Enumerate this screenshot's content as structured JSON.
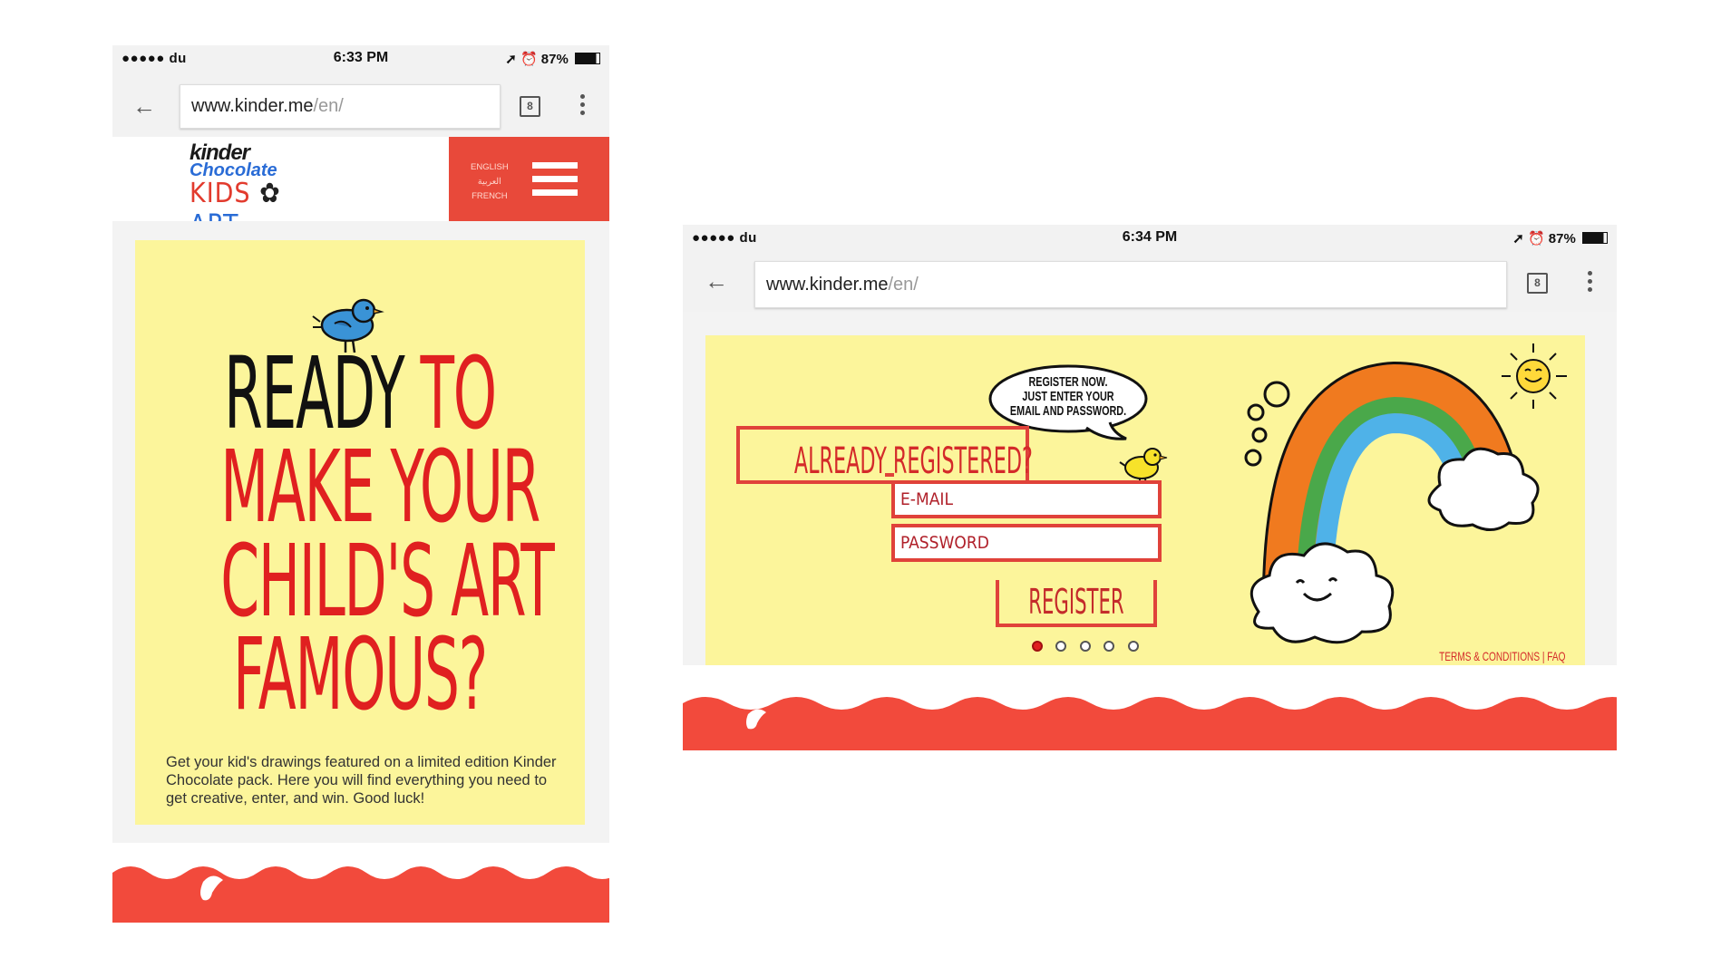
{
  "phone1": {
    "status": {
      "carrier": "●●●●● du",
      "time": "6:33 PM",
      "battery": "87%"
    },
    "browser": {
      "url_host": "www.kinder.me",
      "url_path": "/en/",
      "tab_count": "8"
    },
    "logo": {
      "line1": "kinder",
      "line2": "Chocolate",
      "line3": "KIDS",
      "line4": "ART"
    },
    "languages": [
      "ENGLISH",
      "العربية",
      "FRENCH"
    ],
    "headline": {
      "w1": "READY",
      "w2": "TO",
      "line2": "MAKE YOUR",
      "line3": "CHILD'S ART",
      "line4": "FAMOUS?"
    },
    "intro": "Get your kid's drawings featured on a limited edition Kinder Chocolate pack. Here you will find everything you need to get creative, enter, and win. Good luck!"
  },
  "phone2": {
    "status": {
      "carrier": "●●●●● du",
      "time": "6:34 PM",
      "battery": "87%"
    },
    "browser": {
      "url_host": "www.kinder.me",
      "url_path": "/en/",
      "tab_count": "8"
    },
    "speech_bubble": {
      "line1": "REGISTER NOW.",
      "line2": "JUST ENTER YOUR",
      "line3": "EMAIL AND PASSWORD."
    },
    "already_registered": "ALREADY REGISTERED?",
    "email_placeholder": "E-MAIL",
    "password_placeholder": "PASSWORD",
    "register_label": "REGISTER",
    "pager": {
      "total": 5,
      "active": 0
    },
    "footer": "TERMS & CONDITIONS | FAQ"
  },
  "colors": {
    "kinder_red": "#e8493a",
    "card_yellow": "#fcf59b",
    "text_red": "#e02020"
  },
  "icons": [
    "signal-dots-icon",
    "wifi-icon",
    "location-arrow-icon",
    "alarm-icon",
    "battery-icon",
    "back-arrow-icon",
    "tabs-icon",
    "overflow-menu-icon",
    "hamburger-icon",
    "bird-icon",
    "sun-icon",
    "rainbow-icon",
    "cloud-icon",
    "bubbles-icon"
  ]
}
